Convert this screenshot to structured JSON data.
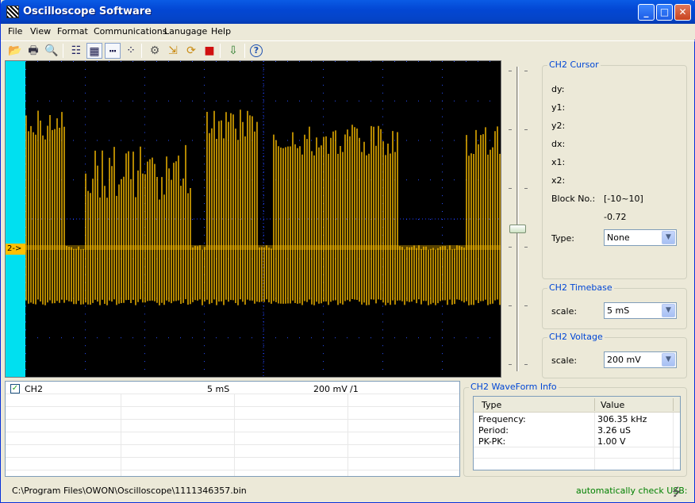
{
  "window": {
    "title": "Oscilloscope Software",
    "minimize": "_",
    "maximize": "□",
    "close": "✕"
  },
  "menu": [
    "File",
    "View",
    "Format",
    "Communications",
    "Lanugage",
    "Help"
  ],
  "toolbar": [
    {
      "name": "open-icon",
      "glyph": "📂"
    },
    {
      "name": "print-icon",
      "glyph": "🖶"
    },
    {
      "name": "print-preview-icon",
      "glyph": "🔍"
    },
    {
      "name": "list-icon",
      "glyph": "☷"
    },
    {
      "name": "grid-icon",
      "glyph": "▦"
    },
    {
      "name": "dotted-line-icon",
      "glyph": "┅"
    },
    {
      "name": "dots-icon",
      "glyph": "⁘"
    },
    {
      "name": "settings-icon",
      "glyph": "⚙"
    },
    {
      "name": "import-icon",
      "glyph": "⇲"
    },
    {
      "name": "refresh-icon",
      "glyph": "⟳"
    },
    {
      "name": "stop-icon",
      "glyph": "■"
    },
    {
      "name": "export-icon",
      "glyph": "⇩"
    },
    {
      "name": "help-icon",
      "glyph": "?"
    }
  ],
  "scope": {
    "channel_marker": "2->",
    "trace_color": "#FFC000",
    "left_strip_color": "#00E0F0"
  },
  "cursor": {
    "title": "CH2 Cursor",
    "labels": {
      "dy": "dy:",
      "y1": "y1:",
      "y2": "y2:",
      "dx": "dx:",
      "x1": "x1:",
      "x2": "x2:",
      "block": "Block No.:",
      "type": "Type:"
    },
    "block_range": "[-10~10]",
    "block_value": "-0.72",
    "type_value": "None"
  },
  "timebase": {
    "title": "CH2 Timebase",
    "label": "scale:",
    "value": "5  mS"
  },
  "voltage": {
    "title": "CH2 Voltage",
    "label": "scale:",
    "value": "200 mV"
  },
  "channels": [
    {
      "name": "CH2",
      "checked": true,
      "time": "5  mS",
      "volt": "200 mV",
      "probe": "/1"
    }
  ],
  "waveinfo": {
    "title": "CH2 WaveForm Info",
    "headers": [
      "Type",
      "Value"
    ],
    "rows": [
      [
        "Frequency:",
        "306.35 kHz"
      ],
      [
        "Period:",
        "3.26 uS"
      ],
      [
        "PK-PK:",
        "1.00 V"
      ]
    ]
  },
  "status": {
    "path": "C:\\Program Files\\OWON\\Oscilloscope\\1111346357.bin",
    "usb": "automatically check USB:"
  }
}
